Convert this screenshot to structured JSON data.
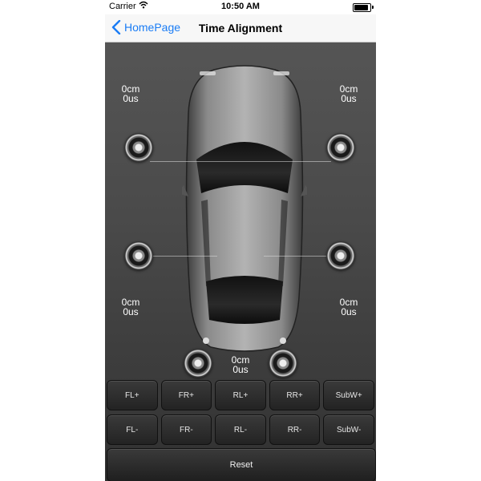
{
  "status_bar": {
    "carrier": "Carrier",
    "time": "10:50 AM"
  },
  "nav": {
    "back_label": "HomePage",
    "title": "Time Alignment"
  },
  "channels": {
    "front_left": {
      "distance": "0cm",
      "delay": "0us"
    },
    "front_right": {
      "distance": "0cm",
      "delay": "0us"
    },
    "rear_left": {
      "distance": "0cm",
      "delay": "0us"
    },
    "rear_right": {
      "distance": "0cm",
      "delay": "0us"
    },
    "subwoofer": {
      "distance": "0cm",
      "delay": "0us"
    }
  },
  "increase_buttons": [
    "FL+",
    "FR+",
    "RL+",
    "RR+",
    "SubW+"
  ],
  "decrease_buttons": [
    "FL-",
    "FR-",
    "RL-",
    "RR-",
    "SubW-"
  ],
  "reset_label": "Reset"
}
